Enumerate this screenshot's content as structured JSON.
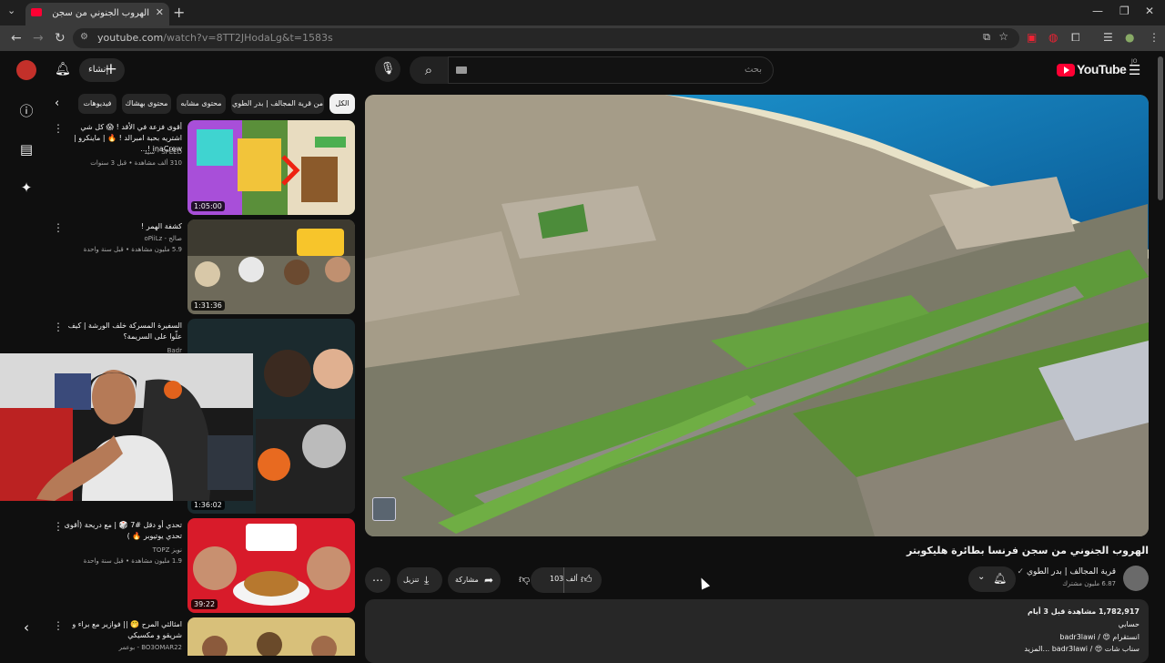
{
  "browser": {
    "tab_title": "الهروب الجنوني من سجن فرنسا",
    "url_host": "youtube.com",
    "url_path": "/watch?v=8TT2JHodaLg&t=1583s"
  },
  "header": {
    "create_label": "إنشاء",
    "search_placeholder": "بحث",
    "logo_text": "YouTube",
    "logo_country": "JO"
  },
  "chips": [
    "الكل",
    "من قرية المجالف | بدر الطوي",
    "محتوى مشابه",
    "محتوى بهشاك",
    "فيديوهات"
  ],
  "recommendations": [
    {
      "title": "أقوى فزعة في الأقد ! 😱 كل شي اشتريه بحبة امبرالد ! 🔥 | ماينكرو | inaCrew !...",
      "channel": "SPEED - سيد",
      "meta": "310 ألف مشاهدة • قبل 3 سنوات",
      "duration": "1:05:00"
    },
    {
      "title": "كشفة الهمر !",
      "channel": "صالح - oPiiLz",
      "meta": "5.9 مليون مشاهدة • قبل سنة واحدة",
      "duration": "1:31:36"
    },
    {
      "title": "السفيرة المسركة خلف الورشة | كيف علّوا على السريمة؟",
      "channel": "Badr",
      "meta": "",
      "duration": "1:36:02"
    },
    {
      "title": "تحدي أو دقل #7 🎲 | مع دريحة (أقوى تحدي يوتيوبر 🔥 )",
      "channel": "نويز TOPZ",
      "meta": "1.9 مليون مشاهدة • قبل سنة واحدة",
      "duration": "39:22"
    },
    {
      "title": "امثالثي المرح 🤭 || فوازير مع براء و شريقو و مكسيكي",
      "channel": "BO3OMAR22 - بوعمر",
      "meta": "",
      "duration": ""
    }
  ],
  "video": {
    "title": "الهروب الجنوني من سجن فرنسا بطائرة هليكوبتر",
    "channel": "قرية المجالف | بدر الطوي",
    "subs": "6.87 مليون مشترك",
    "likes": "103 ألف",
    "share": "مشاركة",
    "download": "تنزيل"
  },
  "description": {
    "views_line": "1,782,917 مشاهدة قبل 3 أيام",
    "line2": "حسابي",
    "line3": "انستقرام 😍 / badr3lawi",
    "line4": "سناب شات 😍 / badr3lawi ...المزيد"
  }
}
